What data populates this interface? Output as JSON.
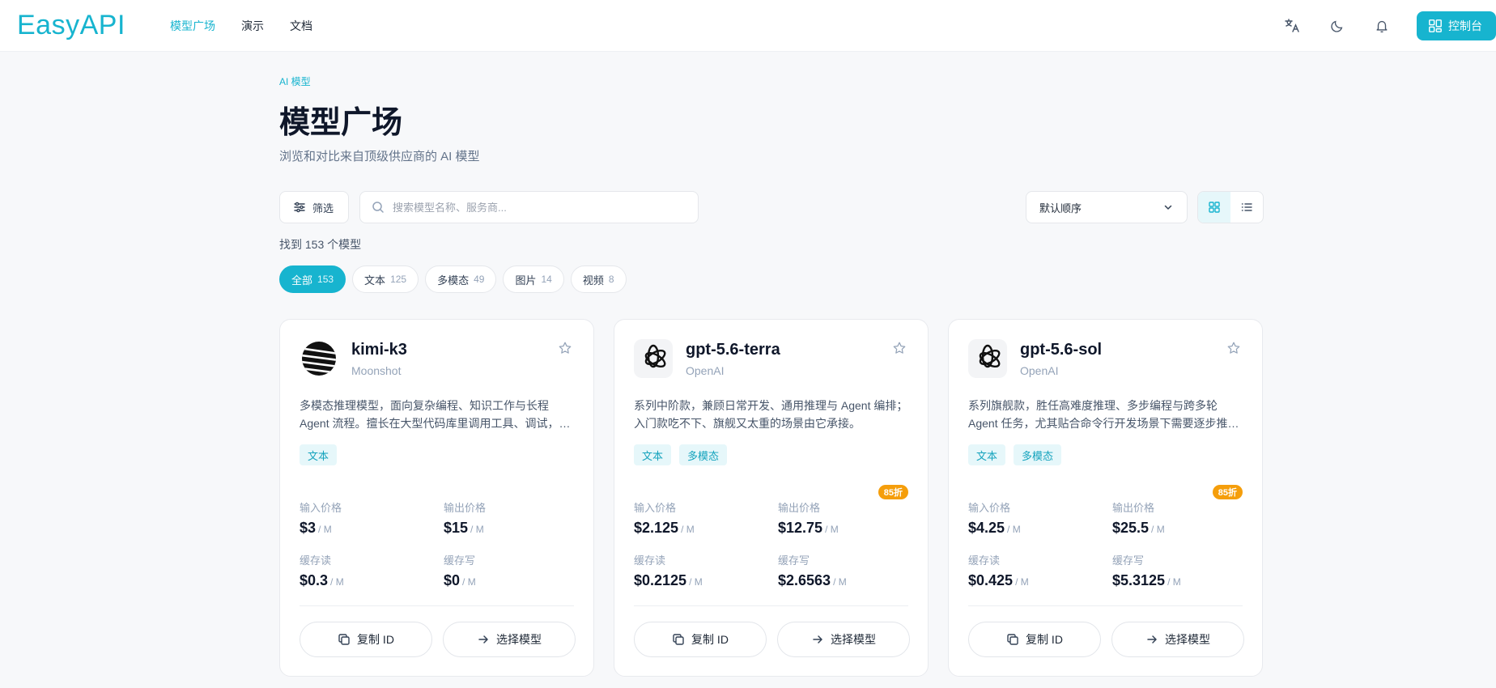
{
  "header": {
    "logo": "EasyAPI",
    "nav": [
      {
        "label": "模型广场",
        "active": true
      },
      {
        "label": "演示"
      },
      {
        "label": "文档"
      }
    ],
    "console_label": "控制台"
  },
  "page": {
    "eyebrow": "AI 模型",
    "title": "模型广场",
    "subtitle": "浏览和对比来自顶级供应商的 AI 模型"
  },
  "toolbar": {
    "filter_label": "筛选",
    "search_placeholder": "搜索模型名称、服务商...",
    "sort_value": "默认顺序",
    "view_mode": "grid"
  },
  "results": {
    "count_text": "找到 153 个模型"
  },
  "categories": [
    {
      "label": "全部",
      "count": "153",
      "active": true
    },
    {
      "label": "文本",
      "count": "125"
    },
    {
      "label": "多模态",
      "count": "49"
    },
    {
      "label": "图片",
      "count": "14"
    },
    {
      "label": "视频",
      "count": "8"
    }
  ],
  "labels": {
    "input_price": "输入价格",
    "output_price": "输出价格",
    "cache_read": "缓存读",
    "cache_write": "缓存写",
    "unit": "/ M",
    "copy_id": "复制 ID",
    "select_model": "选择模型"
  },
  "cards": [
    {
      "name": "kimi-k3",
      "provider": "Moonshot",
      "logo": "moonshot-logo",
      "description": "多模态推理模型，面向复杂编程、知识工作与长程 Agent 流程。擅长在大型代码库里调用工具、调试，并完成多步任务。",
      "tags": [
        "文本"
      ],
      "discount": "",
      "input_price": "$3",
      "output_price": "$15",
      "cache_read": "$0.3",
      "cache_write": "$0"
    },
    {
      "name": "gpt-5.6-terra",
      "provider": "OpenAI",
      "logo": "openai-logo",
      "description": "系列中阶款，兼顾日常开发、通用推理与 Agent 编排；入门款吃不下、旗舰又太重的场景由它承接。",
      "tags": [
        "文本",
        "多模态"
      ],
      "discount": "85折",
      "input_price": "$2.125",
      "output_price": "$12.75",
      "cache_read": "$0.2125",
      "cache_write": "$2.6563"
    },
    {
      "name": "gpt-5.6-sol",
      "provider": "OpenAI",
      "logo": "openai-logo",
      "description": "系列旗舰款，胜任高难度推理、多步编程与跨多轮 Agent 任务，尤其贴合命令行开发场景下需要逐步推理的工作。",
      "tags": [
        "文本",
        "多模态"
      ],
      "discount": "85折",
      "input_price": "$4.25",
      "output_price": "$25.5",
      "cache_read": "$0.425",
      "cache_write": "$5.3125"
    }
  ],
  "colors": {
    "accent": "#17b4cf",
    "discount": "#f59e0b",
    "tag_bg": "#e6f7fa"
  }
}
